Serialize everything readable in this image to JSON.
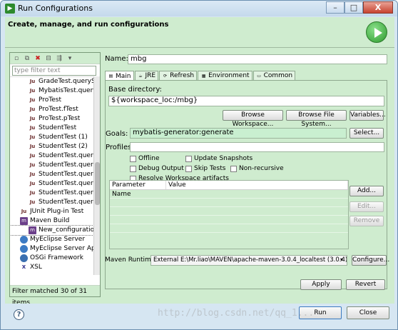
{
  "window": {
    "title": "Run Configurations",
    "minimize": "–",
    "maximize": "□",
    "close": "X"
  },
  "banner": {
    "text": "Create, manage, and run configurations"
  },
  "left_panel": {
    "filter_placeholder": "type filter text",
    "items": [
      {
        "label": "GradeTest.queryS",
        "icon": "junit-icon",
        "indent": 2
      },
      {
        "label": "MybatisTest.query",
        "icon": "junit-icon",
        "indent": 2
      },
      {
        "label": "ProTest",
        "icon": "junit-icon",
        "indent": 2
      },
      {
        "label": "ProTest.fTest",
        "icon": "junit-icon",
        "indent": 2
      },
      {
        "label": "ProTest.pTest",
        "icon": "junit-icon",
        "indent": 2
      },
      {
        "label": "StudentTest",
        "icon": "junit-icon",
        "indent": 2
      },
      {
        "label": "StudentTest (1)",
        "icon": "junit-icon",
        "indent": 2
      },
      {
        "label": "StudentTest (2)",
        "icon": "junit-icon",
        "indent": 2
      },
      {
        "label": "StudentTest.queryS",
        "icon": "junit-icon",
        "indent": 2
      },
      {
        "label": "StudentTest.queryS",
        "icon": "junit-icon",
        "indent": 2
      },
      {
        "label": "StudentTest.query",
        "icon": "junit-icon",
        "indent": 2
      },
      {
        "label": "StudentTest.query",
        "icon": "junit-icon",
        "indent": 2
      },
      {
        "label": "StudentTest.query",
        "icon": "junit-icon",
        "indent": 2
      },
      {
        "label": "StudentTest.query",
        "icon": "junit-icon",
        "indent": 2
      },
      {
        "label": "JUnit Plug-in Test",
        "icon": "junit-icon",
        "indent": 1
      },
      {
        "label": "Maven Build",
        "icon": "maven-icon",
        "indent": 1
      },
      {
        "label": "New_configuratio",
        "icon": "maven-icon",
        "indent": 2,
        "selected": true
      },
      {
        "label": "MyEclipse Server",
        "icon": "myeclipse-server-icon",
        "indent": 1
      },
      {
        "label": "MyEclipse Server Ap",
        "icon": "myeclipse-server-icon",
        "indent": 1
      },
      {
        "label": "OSGi Framework",
        "icon": "osgi-icon",
        "indent": 1
      },
      {
        "label": "XSL",
        "icon": "xsl-icon",
        "indent": 1
      }
    ],
    "status": "Filter matched 30 of 31 items"
  },
  "config": {
    "name_label": "Name:",
    "name_value": "mbg",
    "tabs": [
      {
        "label": "Main",
        "icon": "main-tab-icon",
        "active": true
      },
      {
        "label": "JRE",
        "icon": "jre-tab-icon"
      },
      {
        "label": "Refresh",
        "icon": "refresh-tab-icon"
      },
      {
        "label": "Environment",
        "icon": "environment-tab-icon"
      },
      {
        "label": "Common",
        "icon": "common-tab-icon"
      }
    ],
    "base_dir_label": "Base directory:",
    "base_dir_value": "${workspace_loc:/mbg}",
    "browse_workspace": "Browse Workspace...",
    "browse_file_system": "Browse File System...",
    "variables": "Variables...",
    "goals_label": "Goals:",
    "goals_value": "mybatis-generator:generate",
    "select_button": "Select...",
    "profiles_label": "Profiles:",
    "profiles_value": "",
    "checkboxes": {
      "offline": "Offline",
      "update_snapshots": "Update Snapshots",
      "debug_output": "Debug Output",
      "skip_tests": "Skip Tests",
      "non_recursive": "Non-recursive",
      "resolve_workspace": "Resolve Workspace artifacts"
    },
    "param_columns": [
      "Parameter Name",
      "Value"
    ],
    "add_button": "Add...",
    "edit_button": "Edit...",
    "remove_button": "Remove",
    "runtime_label": "Maven Runtime:",
    "runtime_value": "External E:\\Mr.liao\\MAVEN\\apache-maven-3.0.4_localtest (3.0.4)",
    "configure_button": "Configure...",
    "apply_button": "Apply",
    "revert_button": "Revert"
  },
  "footer": {
    "run_button": "Run",
    "close_button": "Close",
    "watermark": "http://blog.csdn.net/qq_1..."
  }
}
